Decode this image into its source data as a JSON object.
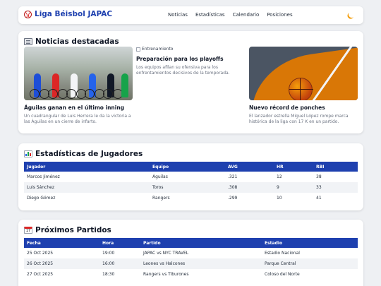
{
  "header": {
    "title": "Liga Béisbol JAPAC",
    "nav": [
      "Noticias",
      "Estadísticas",
      "Calendario",
      "Posiciones"
    ]
  },
  "news": {
    "title": "Noticias destacadas",
    "items": [
      {
        "headline": "Águilas ganan en el último inning",
        "text": "Un cuadrangular de Luis Herrera le da la victoria a las Águilas en un cierre de infarto.",
        "image": "cyclists-photo"
      },
      {
        "headline": "Preparación para los playoffs",
        "text": "Los equipos afilan su ofensiva para los enfrentamientos decisivos de la temporada.",
        "image_alt": "Entrenamiento"
      },
      {
        "headline": "Nuevo récord de ponches",
        "text": "El lanzador estrella Miguel López rompe marca histórica de la liga con 17 K en un partido.",
        "image": "basketball-court-photo"
      }
    ]
  },
  "stats": {
    "title": "Estadísticas de Jugadores",
    "columns": [
      "Jugador",
      "Equipo",
      "AVG",
      "HR",
      "RBI"
    ],
    "rows": [
      [
        "Marcos Jiménez",
        "Águilas",
        ".321",
        "12",
        "38"
      ],
      [
        "Luis Sánchez",
        "Toros",
        ".308",
        "9",
        "33"
      ],
      [
        "Diego Gómez",
        "Rangers",
        ".299",
        "10",
        "41"
      ]
    ]
  },
  "games": {
    "title": "Próximos Partidos",
    "columns": [
      "Fecha",
      "Hora",
      "Partido",
      "Estadio"
    ],
    "rows": [
      [
        "25 Oct 2025",
        "19:00",
        "JAPAC vs NYC TRAVEL",
        "Estadio Nacional"
      ],
      [
        "26 Oct 2025",
        "16:00",
        "Leones vs Halcones",
        "Parque Central"
      ],
      [
        "27 Oct 2025",
        "18:30",
        "Rangers vs Tiburones",
        "Coloso del Norte"
      ]
    ]
  },
  "colors": {
    "accent": "#1e40af",
    "moon": "#f59e0b"
  },
  "icons": {
    "brand": "baseball-icon",
    "theme": "moon-icon",
    "news": "newspaper-icon",
    "stats": "bar-chart-icon",
    "games": "calendar-icon"
  }
}
